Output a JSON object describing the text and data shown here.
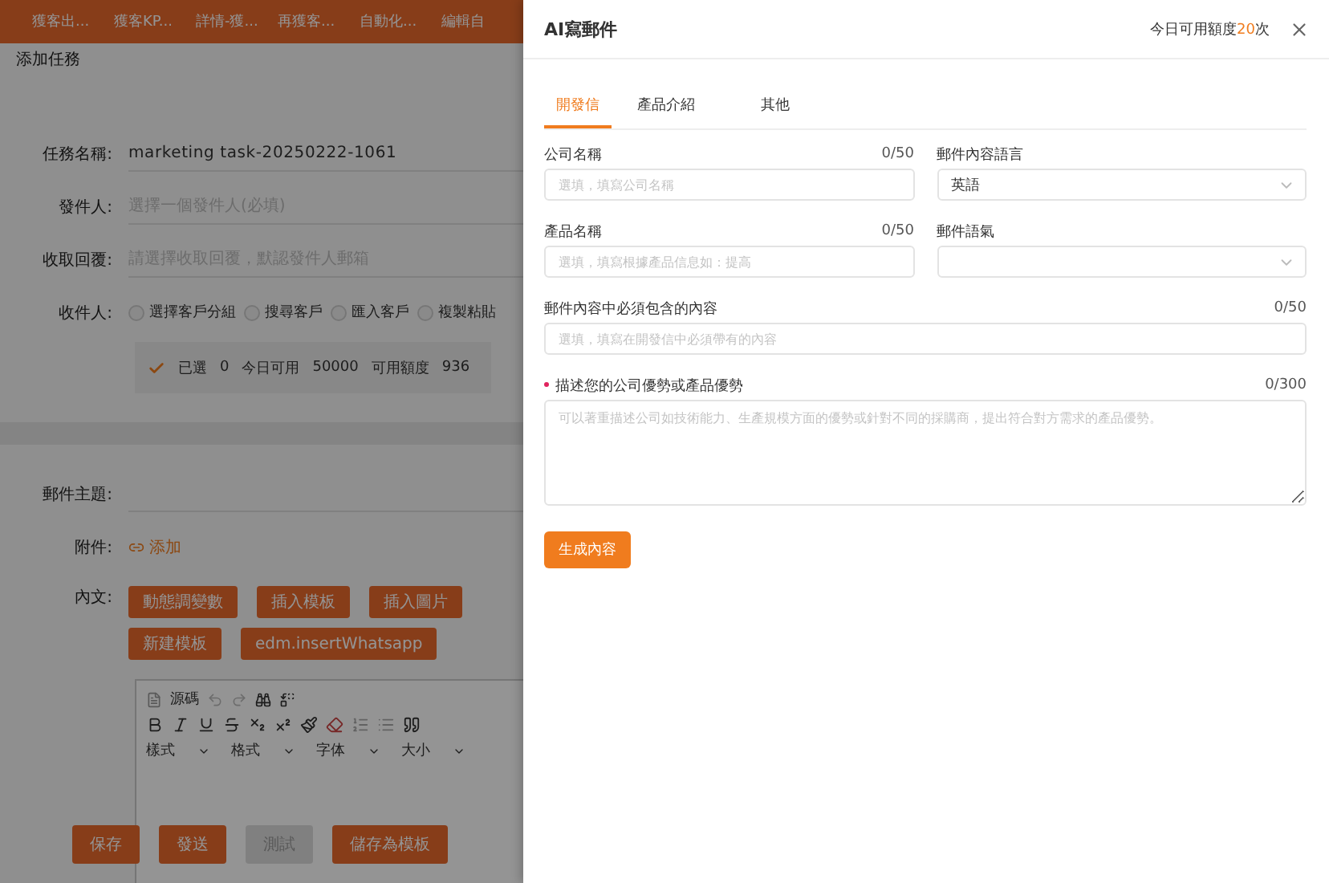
{
  "background_page": {
    "nav_tabs": [
      "獲客出...",
      "獲客KP...",
      "詳情-獲...",
      "再獲客...",
      "自動化...",
      "編輯自"
    ],
    "title": "添加任務",
    "fields": [
      {
        "label": "任務名稱:",
        "value": "marketing task-20250222-1061"
      },
      {
        "label": "發件人:",
        "placeholder": "選擇一個發件人(必填)"
      },
      {
        "label": "收取回覆:",
        "placeholder": "請選擇收取回覆，默認發件人郵箱"
      }
    ],
    "recipients": {
      "label": "收件人:",
      "options": [
        {
          "label": "選擇客戶分組",
          "selected": false
        },
        {
          "label": "搜尋客戶",
          "selected": false
        },
        {
          "label": "匯入客戶",
          "selected": false
        },
        {
          "label": "複製粘貼",
          "selected": false
        }
      ]
    },
    "summary": [
      "已選",
      "0",
      "今日可用",
      "50000",
      "可用額度",
      "936"
    ],
    "subject_label": "郵件主題:",
    "attachment": {
      "label": "附件:",
      "link": "添加"
    },
    "body": {
      "label": "內文:",
      "insert_buttons": [
        "動態調變數",
        "插入模板",
        "插入圖片",
        "新建模板",
        "edm.insertWhatsapp"
      ],
      "source_label": "源碼",
      "dropdowns": [
        "樣式",
        "格式",
        "字体",
        "大小"
      ]
    },
    "actions": [
      {
        "label": "保存",
        "disabled": false
      },
      {
        "label": "發送",
        "disabled": false
      },
      {
        "label": "測試",
        "disabled": true
      },
      {
        "label": "儲存為模板",
        "disabled": false
      }
    ]
  },
  "drawer": {
    "title": "AI寫郵件",
    "quota": {
      "prefix": "今日可用額度",
      "count": "20",
      "suffix": "次"
    },
    "tabs": [
      {
        "label": "開發信",
        "selected": true
      },
      {
        "label": "產品介紹",
        "selected": false
      },
      {
        "label": "其他",
        "selected": false
      }
    ],
    "fields": [
      {
        "kind": "input",
        "label": "公司名稱",
        "counter": "0/50",
        "placeholder": "選填，填寫公司名稱",
        "wide": false,
        "required": false
      },
      {
        "kind": "select",
        "label": "郵件內容語言",
        "value": "英語",
        "wide": false,
        "required": false
      },
      {
        "kind": "input",
        "label": "產品名稱",
        "counter": "0/50",
        "placeholder": "選填，填寫根據產品信息如：提高",
        "wide": false,
        "required": false
      },
      {
        "kind": "select",
        "label": "郵件語氣",
        "wide": false,
        "required": false
      },
      {
        "kind": "input",
        "label": "郵件內容中必須包含的內容",
        "counter": "0/50",
        "placeholder": "選填，填寫在開發信中必須帶有的內容",
        "wide": true,
        "required": false
      },
      {
        "kind": "textarea",
        "label": "描述您的公司優勢或產品優勢",
        "counter": "0/300",
        "placeholder": "可以著重描述公司如技術能力、生產規模方面的優勢或針對不同的採購商，提出符合對方需求的產品優勢。",
        "wide": true,
        "required": true
      }
    ],
    "generate_button": "生成內容"
  }
}
